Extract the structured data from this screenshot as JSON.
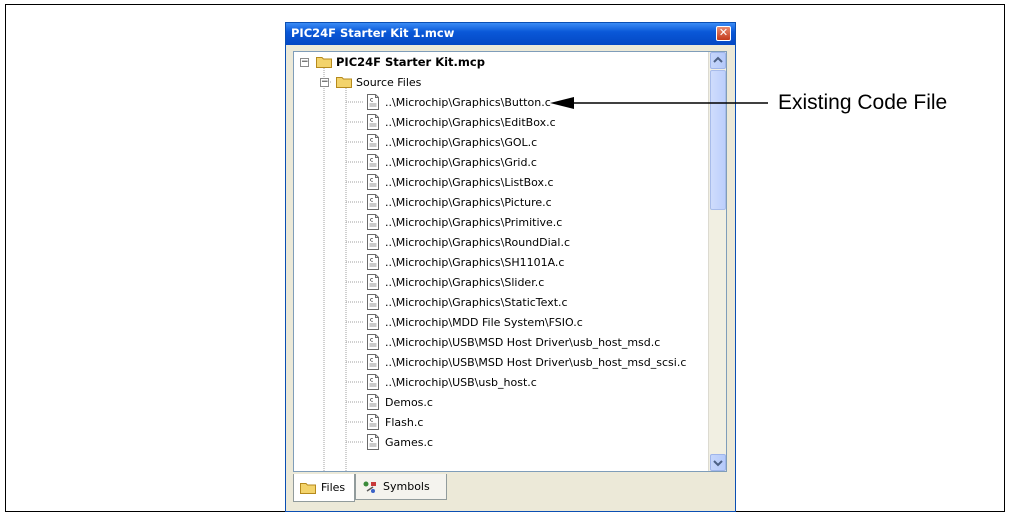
{
  "window": {
    "title": "PIC24F Starter Kit 1.mcw"
  },
  "tree": {
    "project": "PIC24F Starter Kit.mcp",
    "folder": "Source Files",
    "files": [
      "..\\Microchip\\Graphics\\Button.c",
      "..\\Microchip\\Graphics\\EditBox.c",
      "..\\Microchip\\Graphics\\GOL.c",
      "..\\Microchip\\Graphics\\Grid.c",
      "..\\Microchip\\Graphics\\ListBox.c",
      "..\\Microchip\\Graphics\\Picture.c",
      "..\\Microchip\\Graphics\\Primitive.c",
      "..\\Microchip\\Graphics\\RoundDial.c",
      "..\\Microchip\\Graphics\\SH1101A.c",
      "..\\Microchip\\Graphics\\Slider.c",
      "..\\Microchip\\Graphics\\StaticText.c",
      "..\\Microchip\\MDD File System\\FSIO.c",
      "..\\Microchip\\USB\\MSD Host Driver\\usb_host_msd.c",
      "..\\Microchip\\USB\\MSD Host Driver\\usb_host_msd_scsi.c",
      "..\\Microchip\\USB\\usb_host.c",
      "Demos.c",
      "Flash.c",
      "Games.c"
    ]
  },
  "tabs": [
    {
      "label": "Files",
      "icon": "folder-icon",
      "active": true
    },
    {
      "label": "Symbols",
      "icon": "symbols-icon",
      "active": false
    }
  ],
  "callout": {
    "text": "Existing Code File"
  },
  "close_glyph": "✕",
  "colors": {
    "titlebar": "#0a58d8",
    "folder": "#f3d36b",
    "window_bg": "#ece9d8"
  }
}
